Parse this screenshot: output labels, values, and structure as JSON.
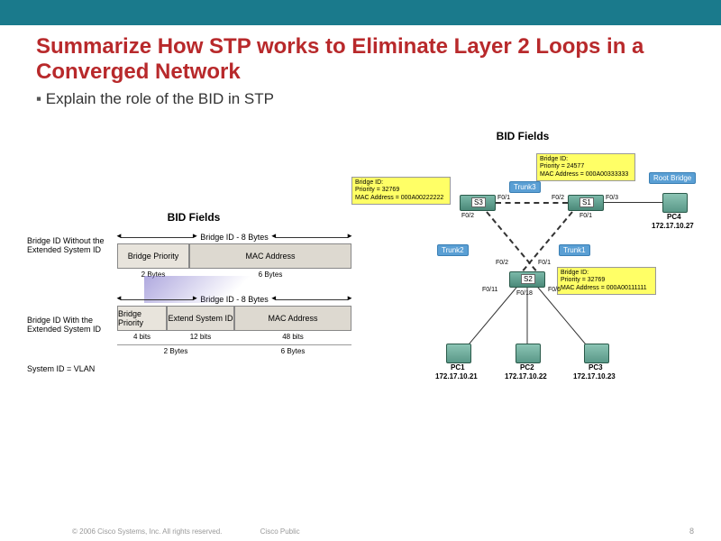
{
  "title": "Summarize How STP works to Eliminate Layer 2 Loops in a Converged Network",
  "bullet": "Explain the role of the BID in STP",
  "left": {
    "heading": "BID Fields",
    "label1": "Bridge ID Without the Extended System ID",
    "label2": "Bridge ID With the Extended System ID",
    "label3": "System ID = VLAN",
    "totalSize": "Bridge ID - 8 Bytes",
    "seg1a": "Bridge Priority",
    "seg1b": "MAC Address",
    "size1a": "2 Bytes",
    "size1b": "6 Bytes",
    "seg2a": "Bridge Priority",
    "seg2b": "Extend System ID",
    "seg2c": "MAC Address",
    "bits2a": "4 bits",
    "bits2b": "12 bits",
    "bits2c": "48 bits",
    "size2a": "2 Bytes",
    "size2b": "6 Bytes"
  },
  "right": {
    "heading": "BID Fields",
    "notes": {
      "n1": {
        "l1": "Bridge ID:",
        "l2": "Priority = 32769",
        "l3": "MAC Address = 000A00222222"
      },
      "n2": {
        "l1": "Bridge ID:",
        "l2": "Priority = 24577",
        "l3": "MAC Address = 000A00333333"
      },
      "n3": {
        "l1": "Bridge ID:",
        "l2": "Priority = 32769",
        "l3": "MAC Address = 000A00111111"
      }
    },
    "tags": {
      "rb": "Root Bridge",
      "t1": "Trunk1",
      "t2": "Trunk2",
      "t3": "Trunk3"
    },
    "switches": {
      "s1": "S1",
      "s2": "S2",
      "s3": "S3"
    },
    "pcs": {
      "pc1": "PC1",
      "pc2": "PC2",
      "pc3": "PC3",
      "pc4": "PC4"
    },
    "ips": {
      "pc1": "172.17.10.21",
      "pc2": "172.17.10.22",
      "pc3": "172.17.10.23",
      "pc4": "172.17.10.27"
    },
    "ports": {
      "s3f01": "F0/1",
      "s3f02": "F0/2",
      "s1f01": "F0/1",
      "s1f02": "F0/2",
      "s1f03": "F0/3",
      "s2f01": "F0/1",
      "s2f02": "F0/2",
      "s2f06": "F0/6",
      "s2f011": "F0/11",
      "s2f018": "F0/18"
    }
  },
  "footer": {
    "copy": "© 2006 Cisco Systems, Inc. All rights reserved.",
    "label": "Cisco Public",
    "page": "8"
  }
}
